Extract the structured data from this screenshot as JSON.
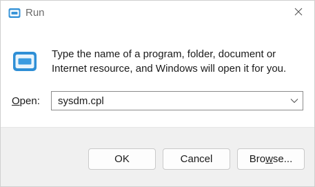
{
  "window": {
    "title": "Run"
  },
  "message": {
    "line1": "Type the name of a program, folder, document or",
    "line2": "Internet resource, and Windows will open it for you."
  },
  "open_field": {
    "label_mnemonic": "O",
    "label_rest": "pen:",
    "value": "sysdm.cpl"
  },
  "buttons": {
    "ok": "OK",
    "cancel": "Cancel",
    "browse_before": "Bro",
    "browse_mnemonic": "w",
    "browse_after": "se..."
  },
  "icons": {
    "app": "run-icon",
    "close": "close-icon",
    "dropdown": "chevron-down-icon"
  },
  "colors": {
    "accent": "#2a86d1",
    "window_bg": "#ffffff",
    "footer_bg": "#f0f0f0"
  }
}
